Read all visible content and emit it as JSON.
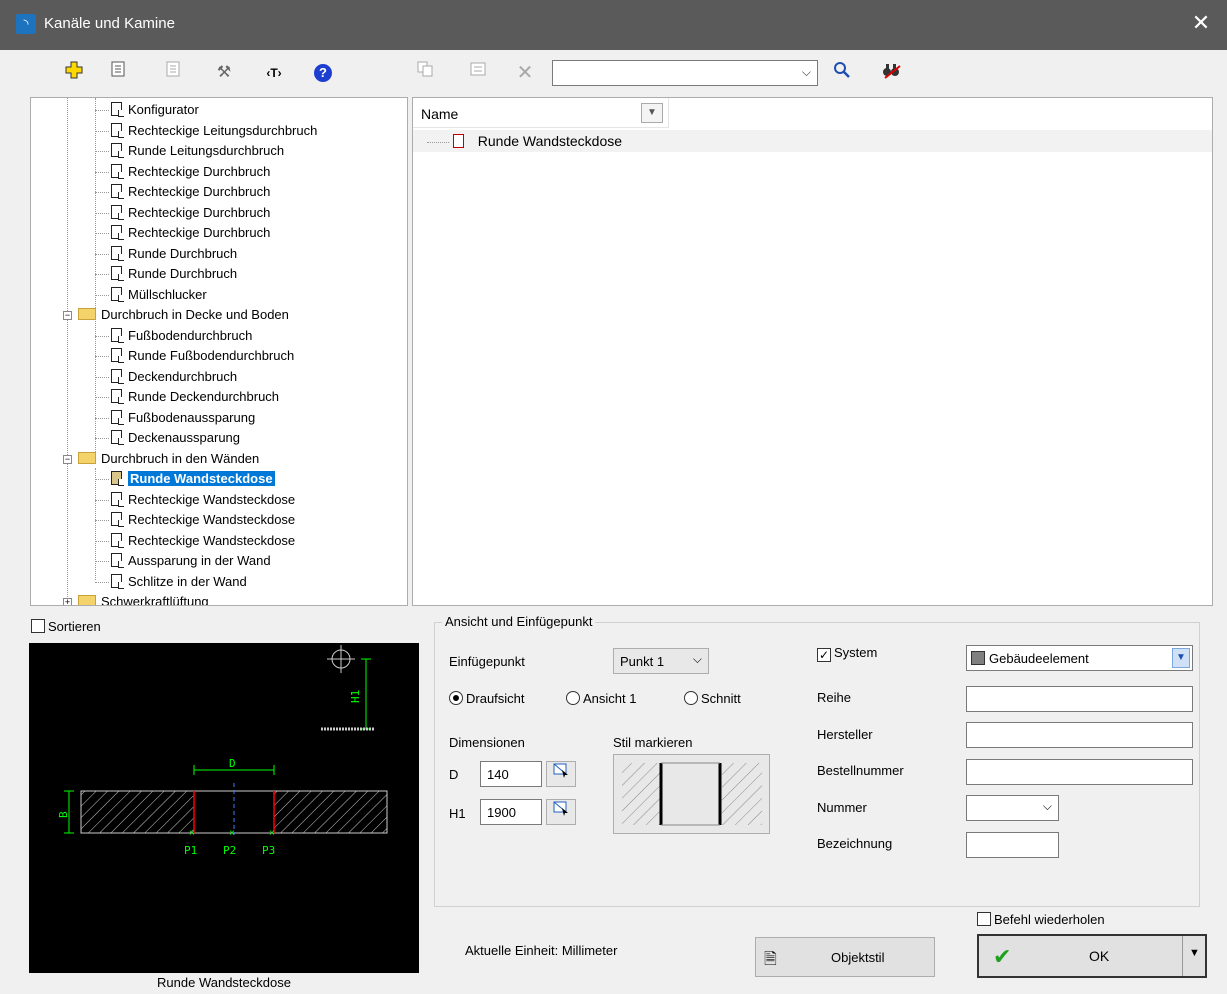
{
  "window": {
    "title": "Kanäle und Kamine",
    "close": "✕"
  },
  "toolbar": {
    "icons": [
      "add-icon",
      "properties-icon",
      "list-icon",
      "tools-icon",
      "text-icon",
      "help-icon",
      "copy-icon",
      "details-icon",
      "delete-icon",
      "search-icon",
      "find-icon"
    ],
    "help_glyph": "?",
    "text_glyph": "‹T›",
    "search_value": ""
  },
  "tree": {
    "items": [
      {
        "label": "Konfigurator",
        "type": "doc"
      },
      {
        "label": "Rechteckige Leitungsdurchbruch",
        "type": "doc"
      },
      {
        "label": "Runde Leitungsdurchbruch",
        "type": "doc"
      },
      {
        "label": "Rechteckige Durchbruch",
        "type": "doc"
      },
      {
        "label": "Rechteckige Durchbruch",
        "type": "doc"
      },
      {
        "label": "Rechteckige Durchbruch",
        "type": "doc"
      },
      {
        "label": "Rechteckige Durchbruch",
        "type": "doc"
      },
      {
        "label": "Runde Durchbruch",
        "type": "doc"
      },
      {
        "label": "Runde Durchbruch",
        "type": "doc"
      },
      {
        "label": "Müllschlucker",
        "type": "doc"
      },
      {
        "label": "Durchbruch in Decke und Boden",
        "type": "folder"
      },
      {
        "label": "Fußbodendurchbruch",
        "type": "doc"
      },
      {
        "label": "Runde Fußbodendurchbruch",
        "type": "doc"
      },
      {
        "label": "Deckendurchbruch",
        "type": "doc"
      },
      {
        "label": "Runde Deckendurchbruch",
        "type": "doc"
      },
      {
        "label": "Fußbodenaussparung",
        "type": "doc"
      },
      {
        "label": "Deckenaussparung",
        "type": "doc"
      },
      {
        "label": "Durchbruch in den Wänden",
        "type": "folder"
      },
      {
        "label": "Runde Wandsteckdose",
        "type": "doc",
        "selected": true
      },
      {
        "label": "Rechteckige Wandsteckdose",
        "type": "doc"
      },
      {
        "label": "Rechteckige Wandsteckdose",
        "type": "doc"
      },
      {
        "label": "Rechteckige Wandsteckdose",
        "type": "doc"
      },
      {
        "label": "Aussparung in der Wand",
        "type": "doc"
      },
      {
        "label": "Schlitze in der Wand",
        "type": "doc"
      },
      {
        "label": "Schwerkraftlüftung",
        "type": "folder"
      }
    ]
  },
  "list": {
    "header": "Name",
    "rows": [
      "Runde Wandsteckdose"
    ]
  },
  "sort": {
    "label": "Sortieren",
    "checked": false
  },
  "preview": {
    "caption": "Runde Wandsteckdose",
    "labels": {
      "d": "D",
      "b": "B",
      "h1": "H1",
      "p1": "P1",
      "p2": "P2",
      "p3": "P3"
    }
  },
  "insert": {
    "group_title": "Ansicht und Einfügepunkt",
    "point_label": "Einfügepunkt",
    "point_value": "Punkt 1",
    "views": [
      {
        "label": "Draufsicht",
        "selected": true
      },
      {
        "label": "Ansicht 1",
        "selected": false
      },
      {
        "label": "Schnitt",
        "selected": false
      }
    ],
    "dimensions_label": "Dimensionen",
    "style_label": "Stil markieren",
    "dims": [
      {
        "name": "D",
        "value": "140"
      },
      {
        "name": "H1",
        "value": "1900"
      }
    ]
  },
  "props": {
    "system_label": "System",
    "system_checked": true,
    "system_value": "Gebäudeelement",
    "reihe": "Reihe",
    "hersteller": "Hersteller",
    "bestellnummer": "Bestellnummer",
    "nummer": "Nummer",
    "bezeichnung": "Bezeichnung"
  },
  "footer": {
    "unit": "Aktuelle Einheit: Millimeter",
    "objektstil": "Objektstil",
    "repeat": "Befehl wiederholen",
    "ok": "OK"
  },
  "colors": {
    "titlebar": "#5a5a5a",
    "selection": "#0078d7",
    "accent_green": "#00cc00"
  }
}
